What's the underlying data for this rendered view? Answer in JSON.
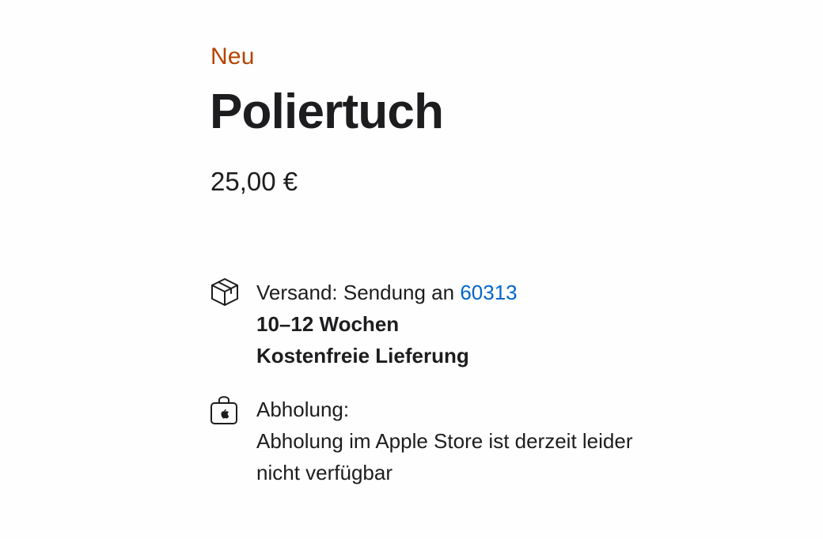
{
  "product": {
    "badge": "Neu",
    "title": "Poliertuch",
    "price": "25,00 €"
  },
  "shipping": {
    "icon": "package-icon",
    "label": "Versand: Sendung an",
    "postal_code": "60313",
    "duration": "10–12 Wochen",
    "cost": "Kostenfreie Lieferung"
  },
  "pickup": {
    "icon": "shopping-bag-apple-icon",
    "label": "Abholung:",
    "message_line1": "Abholung im Apple Store ist derzeit leider",
    "message_line2": "nicht verfügbar"
  },
  "colors": {
    "badge": "#b64400",
    "link": "#0066cc",
    "text": "#1d1d1f"
  }
}
